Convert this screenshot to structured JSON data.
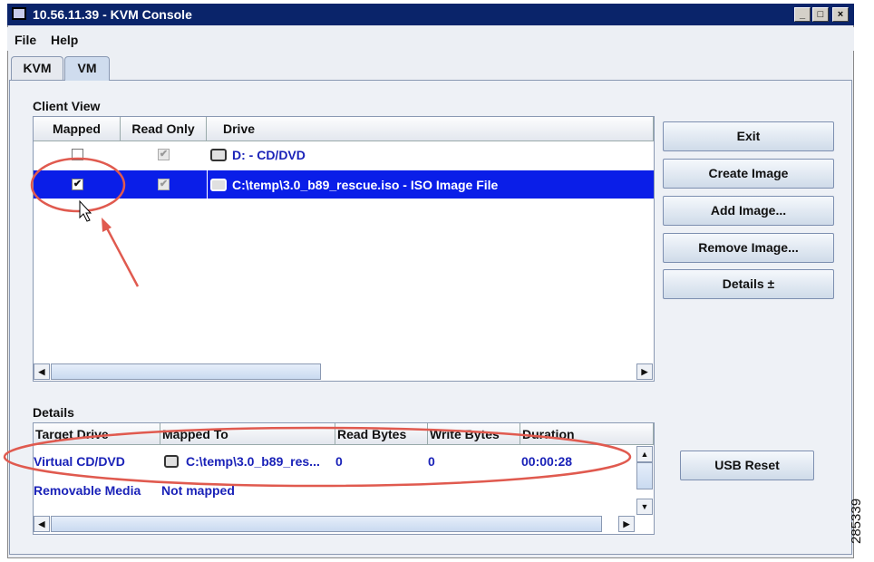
{
  "window": {
    "title": "10.56.11.39 - KVM Console",
    "controls": [
      "_",
      "□",
      "×"
    ]
  },
  "menu": [
    "File",
    "Help"
  ],
  "tabs": [
    {
      "label": "KVM",
      "selected": false
    },
    {
      "label": "VM",
      "selected": true
    }
  ],
  "client_view": {
    "label": "Client View",
    "columns": [
      "Mapped",
      "Read Only",
      "Drive"
    ],
    "rows": [
      {
        "mapped": false,
        "read_only": true,
        "drive": "D: - CD/DVD",
        "selected": false
      },
      {
        "mapped": true,
        "read_only": true,
        "drive": "C:\\temp\\3.0_b89_rescue.iso - ISO Image File",
        "selected": true
      }
    ]
  },
  "buttons": {
    "exit": "Exit",
    "create_image": "Create Image",
    "add_image": "Add Image...",
    "remove_image": "Remove Image...",
    "details": "Details ±",
    "usb_reset": "USB Reset"
  },
  "details": {
    "label": "Details",
    "columns": [
      "Target Drive",
      "Mapped To",
      "Read Bytes",
      "Write Bytes",
      "Duration"
    ],
    "rows": [
      {
        "target": "Virtual CD/DVD",
        "mapped_to": "C:\\temp\\3.0_b89_res...",
        "read": "0",
        "write": "0",
        "duration": "00:00:28"
      },
      {
        "target": "Removable Media",
        "mapped_to": "Not mapped",
        "read": "",
        "write": "",
        "duration": ""
      }
    ]
  },
  "figure_id": "285339",
  "colors": {
    "title_bar": "#0a246a",
    "selection": "#0a1ee8",
    "link_text": "#1a22b8",
    "annotation": "#e05a4f"
  }
}
